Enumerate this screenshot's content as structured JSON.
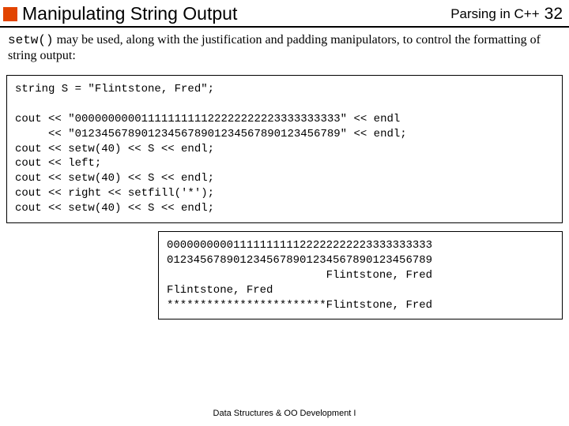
{
  "header": {
    "title": "Manipulating String Output",
    "course": "Parsing in C++",
    "page": "32"
  },
  "intro": {
    "mono": "setw()",
    "rest": " may be used, along with the justification and padding manipulators, to control the formatting of string output:"
  },
  "code": {
    "line1": "string S = \"Flintstone, Fred\";",
    "line2": "cout << \"0000000000111111111122222222223333333333\" << endl",
    "line3": "     << \"0123456789012345678901234567890123456789\" << endl;",
    "line4": "cout << setw(40) << S << endl;",
    "line5": "cout << left;",
    "line6": "cout << setw(40) << S << endl;",
    "line7": "cout << right << setfill('*');",
    "line8": "cout << setw(40) << S << endl;"
  },
  "output": {
    "l1": "0000000000111111111122222222223333333333",
    "l2": "0123456789012345678901234567890123456789",
    "l3": "                        Flintstone, Fred",
    "l4": "Flintstone, Fred",
    "l5": "************************Flintstone, Fred"
  },
  "footer": "Data Structures & OO Development I"
}
